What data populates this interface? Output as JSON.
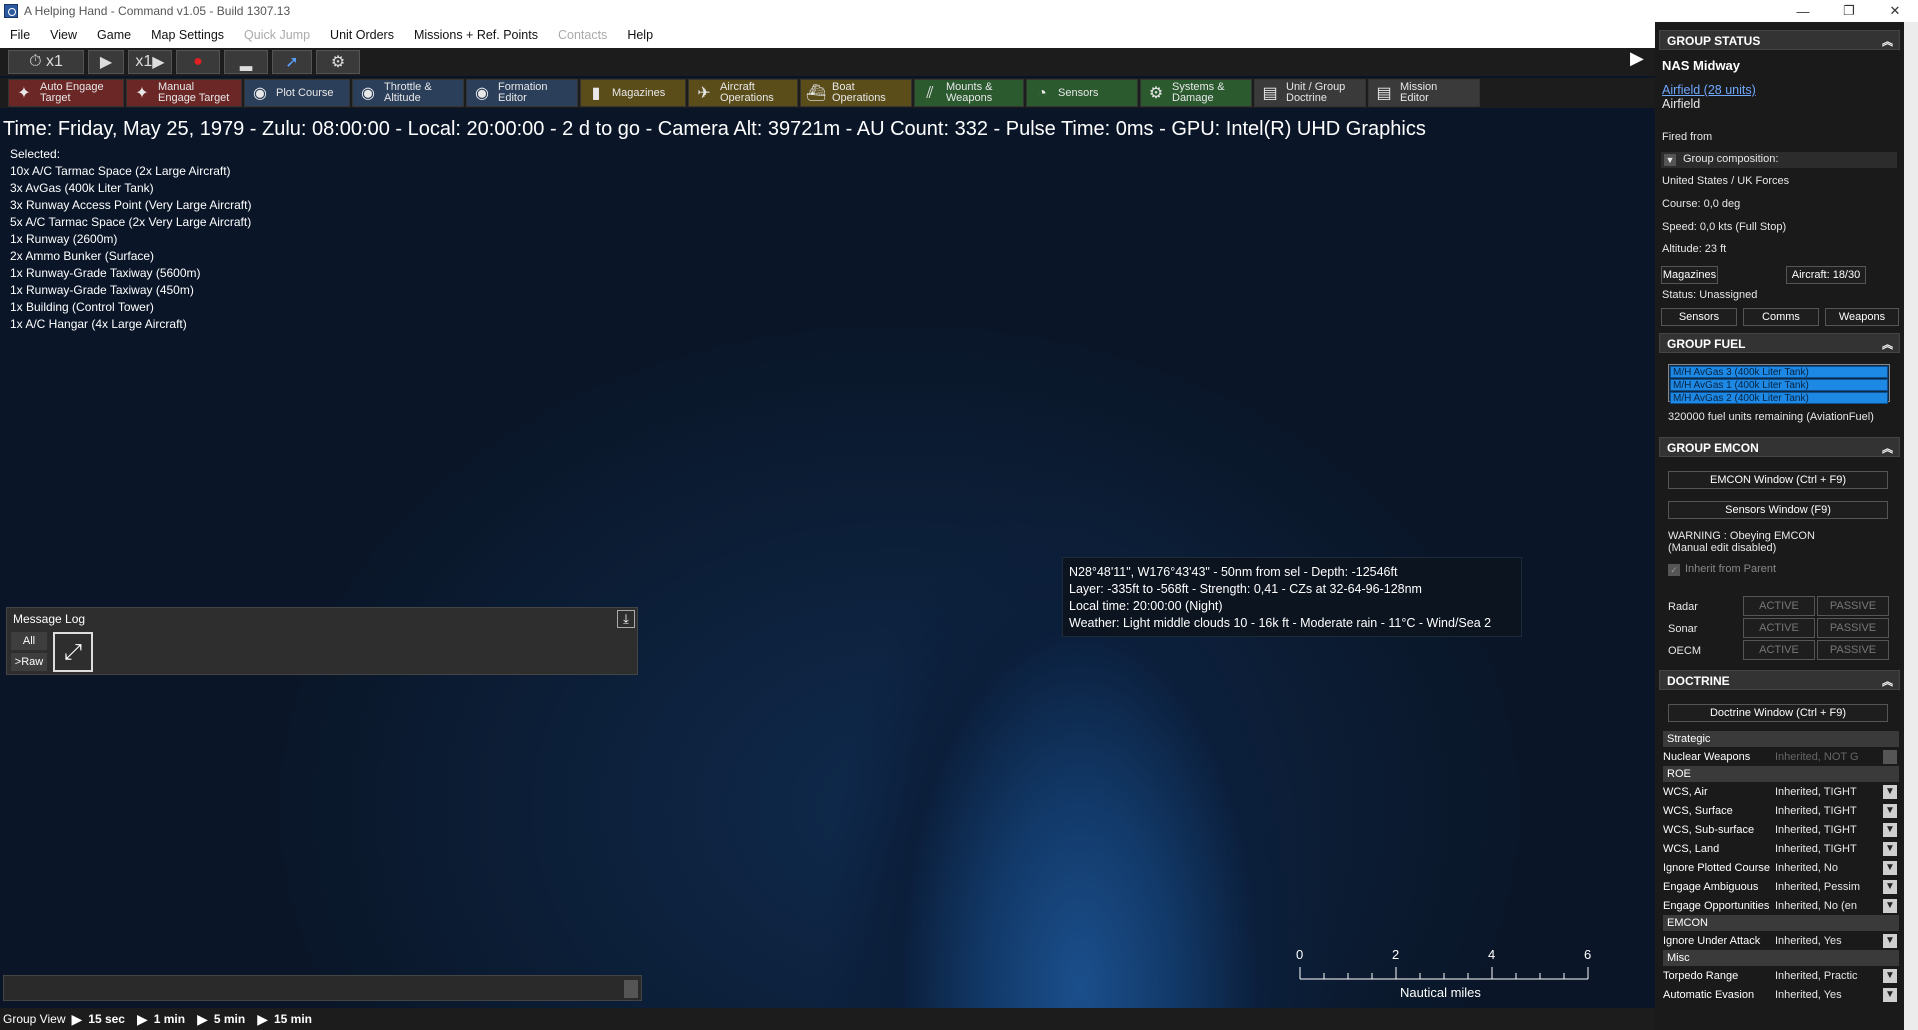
{
  "window": {
    "title": "A Helping Hand - Command v1.05 - Build 1307.13",
    "minimize": "—",
    "maximize": "❐",
    "close": "✕"
  },
  "menu": [
    "File",
    "View",
    "Game",
    "Map Settings",
    "Quick Jump",
    "Unit Orders",
    "Missions + Ref. Points",
    "Contacts",
    "Help"
  ],
  "toolbar1": {
    "time_compression": "x1",
    "speed": "x1"
  },
  "toolbar2": [
    {
      "label": "Auto Engage\nTarget",
      "icon": "auto-engage-icon",
      "color": "red"
    },
    {
      "label": "Manual\nEngage Target",
      "icon": "manual-engage-icon",
      "color": "red"
    },
    {
      "label": "Plot Course",
      "icon": "plot-course-icon",
      "color": "blue"
    },
    {
      "label": "Throttle &\nAltitude",
      "icon": "throttle-icon",
      "color": "blue"
    },
    {
      "label": "Formation\nEditor",
      "icon": "formation-icon",
      "color": "blue"
    },
    {
      "label": "Magazines",
      "icon": "magazines-icon",
      "color": "olive"
    },
    {
      "label": "Aircraft\nOperations",
      "icon": "aircraft-icon",
      "color": "olive"
    },
    {
      "label": "Boat\nOperations",
      "icon": "boat-icon",
      "color": "olive"
    },
    {
      "label": "Mounts &\nWeapons",
      "icon": "mounts-icon",
      "color": "green"
    },
    {
      "label": "Sensors",
      "icon": "sensors-icon",
      "color": "green"
    },
    {
      "label": "Systems &\nDamage",
      "icon": "systems-icon",
      "color": "green"
    },
    {
      "label": "Unit / Group\nDoctrine",
      "icon": "doctrine-icon",
      "color": "gray"
    },
    {
      "label": "Mission\nEditor",
      "icon": "mission-editor-icon",
      "color": "gray"
    }
  ],
  "info_line": "Time: Friday, May 25, 1979 - Zulu: 08:00:00 - Local: 20:00:00 - 2 d to go -  Camera Alt: 39721m  - AU Count: 332 - Pulse Time: 0ms - GPU: Intel(R) UHD Graphics",
  "selected": {
    "title": "Selected:",
    "items": [
      "10x A/C Tarmac Space (2x Large Aircraft)",
      "3x AvGas (400k Liter Tank)",
      "3x Runway Access Point (Very Large Aircraft)",
      "5x A/C Tarmac Space (2x Very Large Aircraft)",
      "1x Runway (2600m)",
      "2x Ammo Bunker (Surface)",
      "1x Runway-Grade Taxiway (5600m)",
      "1x Runway-Grade Taxiway (450m)",
      "1x Building (Control Tower)",
      "1x A/C Hangar (4x Large Aircraft)"
    ]
  },
  "tooltip": [
    "N28°48'11\", W176°43'43\" - 50nm from sel - Depth: -12546ft",
    "Layer: -335ft to -568ft - Strength: 0,41 - CZs at 32-64-96-128nm",
    "Local time: 20:00:00 (Night)",
    "Weather: Light middle clouds 10 - 16k ft - Moderate rain - 11°C - Wind/Sea 2"
  ],
  "message_log": {
    "title": "Message Log",
    "all": "All",
    "raw": ">Raw"
  },
  "scale": {
    "ticks": [
      "0",
      "2",
      "4",
      "6"
    ],
    "unit": "Nautical miles"
  },
  "bottom": {
    "label": "Group View",
    "steps": [
      "15 sec",
      "1 min",
      "5 min",
      "15 min"
    ]
  },
  "panel": {
    "group_status": {
      "header": "GROUP STATUS",
      "name": "NAS Midway",
      "link": "Airfield (28 units)",
      "type": "Airfield",
      "fired_from": "Fired from",
      "composition_label": "Group composition:",
      "side": "United States / UK Forces",
      "course": "Course: 0,0 deg",
      "speed": "Speed: 0,0 kts (Full Stop)",
      "altitude": "Altitude: 23 ft",
      "magazines": "Magazines",
      "aircraft": "Aircraft: 18/30",
      "status": "Status: Unassigned",
      "sensors": "Sensors",
      "comms": "Comms",
      "weapons": "Weapons"
    },
    "group_fuel": {
      "header": "GROUP FUEL",
      "tanks": [
        "M/H AvGas 3 (400k Liter Tank)",
        "M/H AvGas 1 (400k Liter Tank)",
        "M/H AvGas 2 (400k Liter Tank)"
      ],
      "remaining": "320000 fuel units remaining (AviationFuel)"
    },
    "group_emcon": {
      "header": "GROUP EMCON",
      "emcon_window": "EMCON Window (Ctrl + F9)",
      "sensors_window": "Sensors Window (F9)",
      "warning": "WARNING : Obeying EMCON",
      "warning2": "(Manual edit disabled)",
      "inherit": "Inherit from Parent",
      "rows": [
        {
          "label": "Radar",
          "active": "ACTIVE",
          "passive": "PASSIVE"
        },
        {
          "label": "Sonar",
          "active": "ACTIVE",
          "passive": "PASSIVE"
        },
        {
          "label": "OECM",
          "active": "ACTIVE",
          "passive": "PASSIVE"
        }
      ]
    },
    "doctrine": {
      "header": "DOCTRINE",
      "window": "Doctrine Window (Ctrl + F9)",
      "strategic": "Strategic",
      "nuclear": {
        "k": "Nuclear Weapons",
        "v": "Inherited, NOT G"
      },
      "roe": "ROE",
      "roe_rows": [
        {
          "k": "WCS, Air",
          "v": "Inherited, TIGHT"
        },
        {
          "k": "WCS, Surface",
          "v": "Inherited, TIGHT"
        },
        {
          "k": "WCS, Sub-surface",
          "v": "Inherited, TIGHT"
        },
        {
          "k": "WCS, Land",
          "v": "Inherited, TIGHT"
        },
        {
          "k": "Ignore Plotted Course",
          "v": "Inherited, No"
        },
        {
          "k": "Engage Ambiguous",
          "v": "Inherited, Pessim"
        },
        {
          "k": "Engage Opportunities",
          "v": "Inherited, No (en"
        }
      ],
      "emcon": "EMCON",
      "emcon_rows": [
        {
          "k": "Ignore Under Attack",
          "v": "Inherited, Yes"
        }
      ],
      "misc": "Misc",
      "misc_rows": [
        {
          "k": "Torpedo Range",
          "v": "Inherited, Practic"
        },
        {
          "k": "Automatic Evasion",
          "v": "Inherited, Yes"
        }
      ]
    }
  }
}
